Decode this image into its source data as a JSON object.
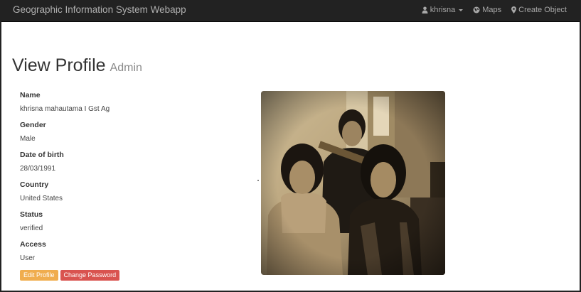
{
  "navbar": {
    "brand": "Geographic Information System Webapp",
    "user_menu": "khrisna",
    "maps": "Maps",
    "create_object": "Create Object"
  },
  "page": {
    "title": "View Profile",
    "subtitle": "Admin"
  },
  "profile": {
    "name_label": "Name",
    "name_value": "khrisna mahautama I Gst Ag",
    "gender_label": "Gender",
    "gender_value": "Male",
    "dob_label": "Date of birth",
    "dob_value": "28/03/1991",
    "country_label": "Country",
    "country_value": "United States",
    "status_label": "Status",
    "status_value": "verified",
    "access_label": "Access",
    "access_value": "User"
  },
  "actions": {
    "edit_profile": "Edit Profile",
    "change_password": "Change Password"
  },
  "colors": {
    "navbar": "#222222",
    "warning": "#f0ad4e",
    "danger": "#d9534f"
  }
}
